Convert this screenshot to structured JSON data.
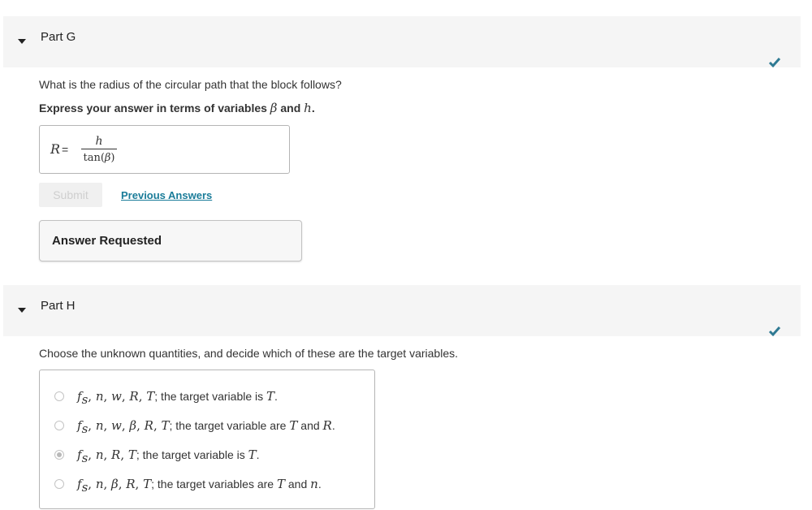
{
  "partG": {
    "title": "Part G",
    "question": "What is the radius of the circular path that the block follows?",
    "instruction_prefix": "Express your answer in terms of variables",
    "instruction_var1": "β",
    "instruction_and": "and",
    "instruction_var2": "h",
    "instruction_end": ".",
    "answer": {
      "lhs": "R",
      "equals": "=",
      "numerator": "h",
      "den_func": "tan(",
      "den_var": "β",
      "den_close": ")"
    },
    "submit_label": "Submit",
    "previous_answers_label": "Previous Answers",
    "status_label": "Answer Requested",
    "check_color": "#2f7a93"
  },
  "partH": {
    "title": "Part H",
    "question": "Choose the unknown quantities, and decide which of these are the target variables.",
    "selected_option": 3,
    "options": [
      {
        "vars": [
          "f",
          "n",
          "w",
          "R",
          "T"
        ],
        "sub": "s",
        "text": "; the target variable is ",
        "t1": "T",
        "t2": "",
        "end": "."
      },
      {
        "vars": [
          "f",
          "n",
          "w",
          "β",
          "R",
          "T"
        ],
        "sub": "s",
        "text": "; the target variable are ",
        "t1": "T",
        "mid": " and ",
        "t2": "R",
        "end": "."
      },
      {
        "vars": [
          "f",
          "n",
          "R",
          "T"
        ],
        "sub": "s",
        "text": "; the target variable is ",
        "t1": "T",
        "t2": "",
        "end": "."
      },
      {
        "vars": [
          "f",
          "n",
          "β",
          "R",
          "T"
        ],
        "sub": "s",
        "text": "; the target variables are ",
        "t1": "T",
        "mid": " and ",
        "t2": "n",
        "end": "."
      }
    ]
  }
}
